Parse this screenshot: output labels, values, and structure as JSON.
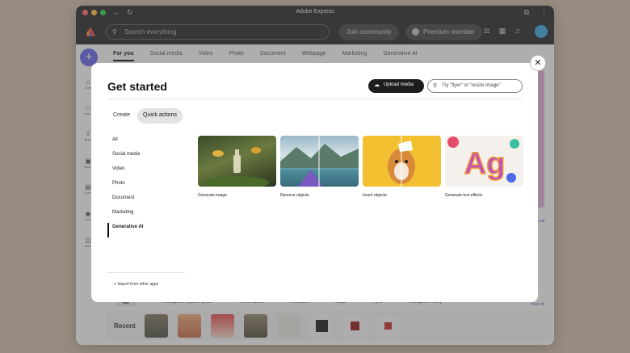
{
  "window": {
    "title": "Adobe Express"
  },
  "topbar": {
    "search_placeholder": "Search everything",
    "join_label": "Join community",
    "premium_label": "Premium member"
  },
  "sidebar": {
    "items": [
      {
        "label": "Hom",
        "icon": "home-icon"
      },
      {
        "label": "Your s",
        "icon": "folder-icon"
      },
      {
        "label": "Bran",
        "icon": "brand-icon"
      },
      {
        "label": "Templ",
        "icon": "templates-icon"
      },
      {
        "label": "Sche",
        "icon": "calendar-icon"
      },
      {
        "label": "Lea",
        "icon": "learn-icon"
      },
      {
        "label": "Add-",
        "icon": "addons-icon"
      }
    ]
  },
  "top_tabs": [
    "For you",
    "Social media",
    "Video",
    "Photo",
    "Document",
    "Webpage",
    "Marketing",
    "Generative AI"
  ],
  "background": {
    "view_all": "View all",
    "chips": [
      "All",
      "Instagram square post",
      "Presentation",
      "Invitation",
      "Logo",
      "Flyer",
      "Instagram story"
    ],
    "recent_label": "Recent"
  },
  "modal": {
    "title": "Get started",
    "upload_label": "Upload media",
    "search_placeholder": "Try \"flyer\" or \"resize image\"",
    "tabs": [
      "Create",
      "Quick actions"
    ],
    "categories": [
      "All",
      "Social media",
      "Video",
      "Photo",
      "Document",
      "Marketing",
      "Generative AI"
    ],
    "selected_category": "Generative AI",
    "import_label": "Import from other apps",
    "cards": [
      {
        "label": "Generate image"
      },
      {
        "label": "Remove objects"
      },
      {
        "label": "Insert objects"
      },
      {
        "label": "Generate text effects"
      }
    ],
    "text_effect_letters": "Ag"
  },
  "colors": {
    "accent": "#5c5ce0",
    "dark": "#1d1d1f"
  }
}
